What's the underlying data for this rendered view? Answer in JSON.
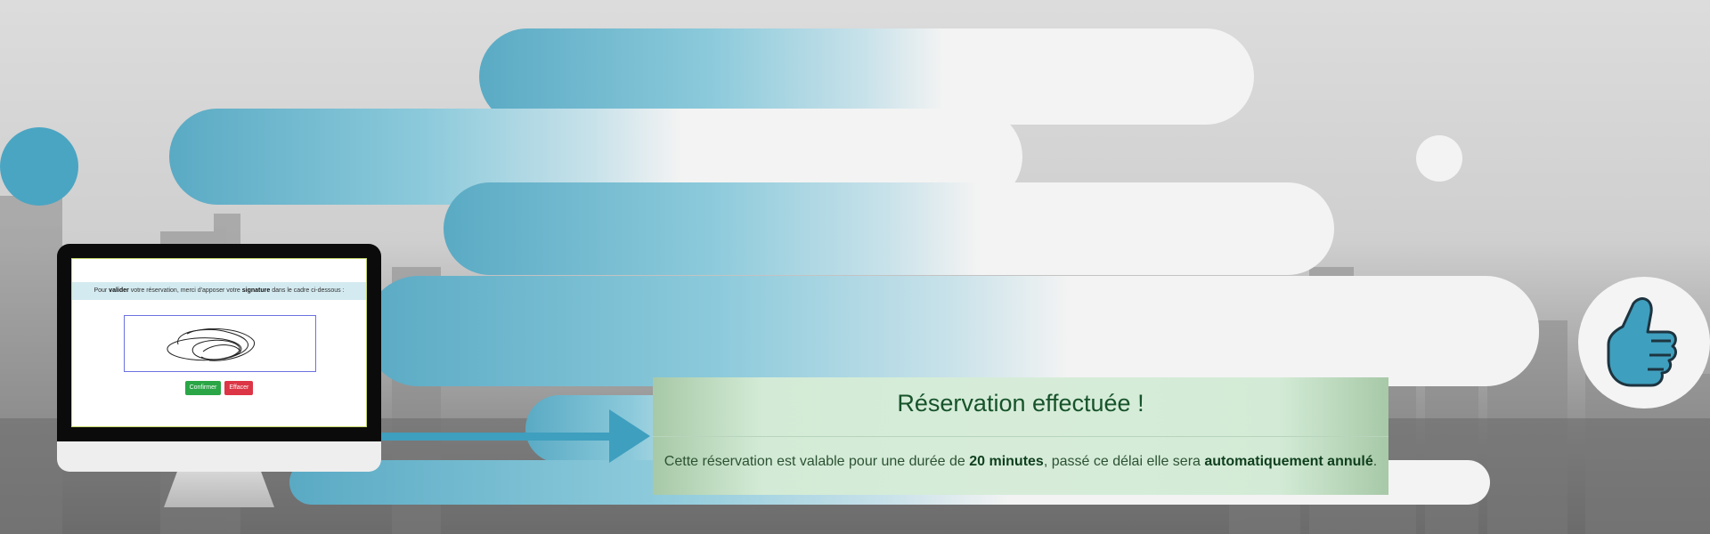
{
  "signature_screen": {
    "instruction_prefix": "Pour ",
    "instruction_bold1": "valider",
    "instruction_mid": " votre réservation, merci d'apposer votre ",
    "instruction_bold2": "signature",
    "instruction_suffix": " dans le cadre ci-dessous :",
    "confirm_label": "Confirmer",
    "clear_label": "Effacer"
  },
  "confirmation": {
    "title": "Réservation effectuée !",
    "body_prefix": "Cette réservation est valable pour une durée de ",
    "body_bold1": "20 minutes",
    "body_mid": ", passé ce délai elle sera ",
    "body_bold2": "automatiquement annulé",
    "body_suffix": "."
  },
  "colors": {
    "accent_blue": "#3f9fbe",
    "success_green": "#2aa646",
    "danger_red": "#dc3545",
    "title_green": "#17532a"
  },
  "icons": {
    "badge": "thumbs-up-icon",
    "flow": "arrow-right-icon"
  }
}
